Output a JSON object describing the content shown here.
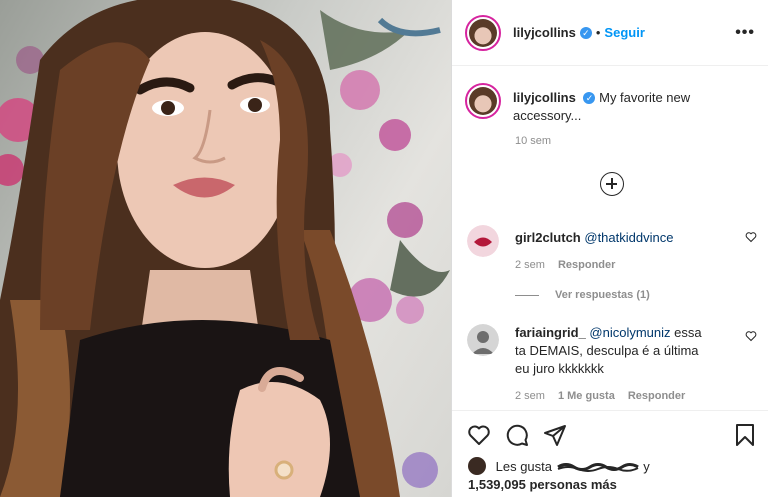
{
  "post": {
    "username": "lilyjcollins",
    "verified_icon": "verified-badge-icon",
    "dot": "•",
    "follow_label": "Seguir",
    "more_label": "•••"
  },
  "caption": {
    "username": "lilyjcollins",
    "text": "My favorite new accessory...",
    "time": "10 sem"
  },
  "comments": [
    {
      "username": "girl2clutch",
      "mention": "@thatkiddvince",
      "text": "",
      "time": "2 sem",
      "reply_label": "Responder",
      "view_replies": "Ver respuestas (1)"
    },
    {
      "username": "fariaingrid_",
      "mention": "@nicolymuniz",
      "text": "essa ta DEMAIS, desculpa é a última eu juro kkkkkkk",
      "time": "2 sem",
      "likes": "1 Me gusta",
      "reply_label": "Responder"
    }
  ],
  "likes": {
    "prefix": "Les gusta",
    "suffix": "y",
    "count_text": "1,539,095 personas más"
  },
  "colors": {
    "accent": "#0095f6",
    "mention": "#00376b",
    "muted": "#8e8e8e",
    "story_ring": "#d6249f"
  }
}
